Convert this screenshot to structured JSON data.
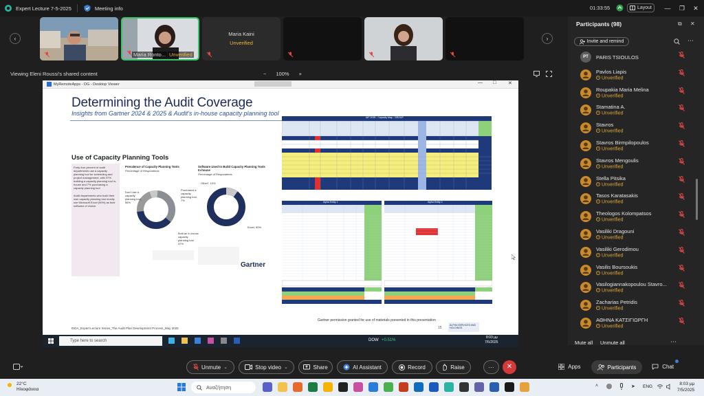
{
  "titlebar": {
    "meeting_title": "Expert Lecture 7-5-2025",
    "meeting_info": "Meeting info",
    "clock": "01:33:55",
    "layout_label": "Layout"
  },
  "video_tiles": [
    {
      "name": "",
      "unverified": ""
    },
    {
      "name": "Maria Ronto...",
      "unverified": "Unverified"
    },
    {
      "name": "Maria Kaini",
      "unverified": "Unverified"
    },
    {
      "name": "",
      "unverified": ""
    },
    {
      "name": "",
      "unverified": ""
    },
    {
      "name": "",
      "unverified": ""
    }
  ],
  "viewing": {
    "label": "Viewing Eleni Roussi's shared content",
    "zoom_minus": "−",
    "zoom_value": "100%",
    "zoom_plus": "+"
  },
  "shared": {
    "rdv_title": "MyRemoteApps - DG - Desktop Viewer",
    "slide_title": "Determining the Audit Coverage",
    "slide_subtitle": "Insights from Gartner 2024 & 2025 & Audit's in-house capacity planning tool",
    "panel_title": "Use of Capacity Planning Tools",
    "left_text_1": "Forty-four percent of audit departments use a capacity planning tool for scheduling and project management, with 37% building a capacity planning tool in-house and 7% purchasing a capacity planning tool",
    "left_text_2": "Audit departments who build their own capacity planning tool mostly use Microsoft Excel (90%) as their software of choice.",
    "donut1_title": "Prevalence of Capacity Planning Tools",
    "donut1_sub": "Percentage of Respondents",
    "donut1_a": "Don't use a capacity planning tool, 56%",
    "donut1_b": "Purchased a capacity planning tool, 7%",
    "donut1_c": "Built an in-house capacity planning tool 37%",
    "donut2_title": "Software Used to Build Capacity Planning Tools In-house",
    "donut2_sub": "Percentage of Respondents",
    "donut2_a": "Other¹, 10%",
    "donut2_b": "Excel, 90%",
    "gartner": "Gartner",
    "credit": "Gartner permission granted for use of materials presented in this presentation",
    "footer": "EIDA_Expert Lecture Series_The Audit Plan Development Process_May 2025",
    "page": "15",
    "brand": "ALPHA SERVICES AND HOLDINGS",
    "table_title": "AIP 2025 - Capacity Map - GROUP",
    "entity1": "Alpha Entity 1",
    "entity2": "Alpha Entity 2",
    "inner_search": "Type here to search",
    "inner_dow": "DOW",
    "inner_dow_val": "+0.51%",
    "inner_time": "8:03 μμ",
    "inner_date": "7/5/2025"
  },
  "panel": {
    "title": "Participants (98)",
    "invite": "Invite and remind",
    "participants": [
      {
        "name": "PARIS TSIOULOS",
        "initials": "PT",
        "unverified": ""
      },
      {
        "name": "Pavlos Liapis",
        "initials": "",
        "unverified": "Unverified"
      },
      {
        "name": "Roupakia Maria Melina",
        "initials": "",
        "unverified": "Unverified"
      },
      {
        "name": "Stamatina A.",
        "initials": "",
        "unverified": "Unverified"
      },
      {
        "name": "Stavros",
        "initials": "",
        "unverified": "Unverified"
      },
      {
        "name": "Stavros Birmpilopoulos",
        "initials": "",
        "unverified": "Unverified"
      },
      {
        "name": "Stavros Mengoulis",
        "initials": "",
        "unverified": "Unverified"
      },
      {
        "name": "Stella Pitsika",
        "initials": "",
        "unverified": "Unverified"
      },
      {
        "name": "Tasos Karatasakis",
        "initials": "",
        "unverified": "Unverified"
      },
      {
        "name": "Theologos Kolompatsos",
        "initials": "",
        "unverified": "Unverified"
      },
      {
        "name": "Vasiliki Dragouni",
        "initials": "",
        "unverified": "Unverified"
      },
      {
        "name": "Vasiliki Gerodimou",
        "initials": "",
        "unverified": "Unverified"
      },
      {
        "name": "Vasilis Boursoukis",
        "initials": "",
        "unverified": "Unverified"
      },
      {
        "name": "Vasilogiannakopoulou Stavro...",
        "initials": "",
        "unverified": "Unverified"
      },
      {
        "name": "Zacharias Petridis",
        "initials": "",
        "unverified": "Unverified"
      },
      {
        "name": "ΑΘΗΝΑ ΚΑΤΣΙΓΙΩΡΓΗ",
        "initials": "",
        "unverified": "Unverified"
      }
    ],
    "mute_all": "Mute all",
    "unmute_all": "Unmute all"
  },
  "toolbar": {
    "unmute": "Unmute",
    "stop_video": "Stop video",
    "share": "Share",
    "ai_assistant": "AI Assistant",
    "record": "Record",
    "raise": "Raise",
    "more": "···",
    "apps": "Apps",
    "participants": "Participants",
    "chat": "Chat"
  },
  "taskbar": {
    "temp": "22°C",
    "weather": "Ηλιοφάνεια",
    "search": "Αναζήτηση",
    "lang": "ENG",
    "time": "8:03 μμ",
    "date": "7/5/2025"
  },
  "colors": {
    "unverified": "#e0a83a",
    "avatar": "#c98a2e",
    "leave": "#d43a3a",
    "mic_off": "#e04848",
    "slide_title": "#1c2a55",
    "table_header": "#1f3a7a"
  }
}
